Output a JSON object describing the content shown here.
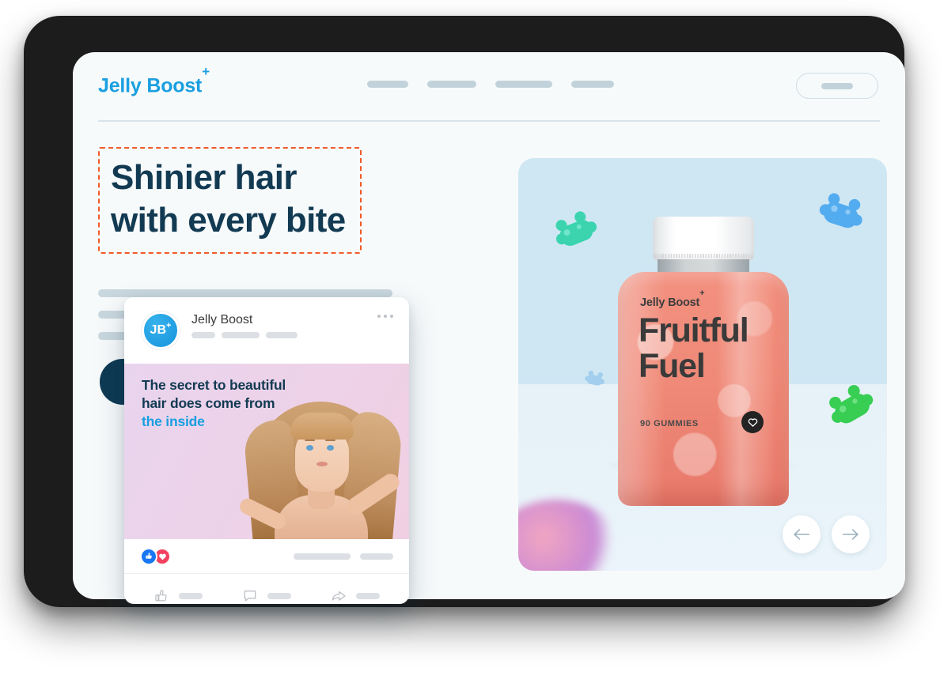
{
  "site": {
    "brand_name": "Jelly Boost",
    "brand_superscript": "+",
    "nav_placeholder_widths": [
      52,
      62,
      72,
      54
    ],
    "header_cta": "header-cta-button"
  },
  "hero": {
    "headline": "Shinier hair\nwith every bite",
    "headline_selected": true,
    "selection_border_color": "#f05a28",
    "headline_color": "#123a52",
    "body_placeholder_lines": 3,
    "cta_button_color": "#0e3a54"
  },
  "product": {
    "panel_background": "#cfe7f3",
    "bottle": {
      "brand": "Jelly Boost",
      "brand_superscript": "+",
      "title": "Fruitful\nFuel",
      "count": "90 GUMMIES",
      "badge_icon": "heart-icon",
      "fill_color": "#f08a78",
      "cap_color": "#ffffff"
    },
    "gummies": [
      {
        "name": "gummy-bear-teal",
        "color": "#2fd3aa"
      },
      {
        "name": "gummy-bear-blue",
        "color": "#4aa8f0"
      },
      {
        "name": "gummy-bear-green",
        "color": "#2ecc4a"
      },
      {
        "name": "gummy-bear-small-blue",
        "color": "#9cc9ec"
      }
    ],
    "carousel": {
      "prev_label": "previous-slide",
      "next_label": "next-slide"
    }
  },
  "social_card": {
    "account_name": "Jelly Boost",
    "avatar_initials": "JB",
    "avatar_superscript": "+",
    "avatar_color": "#1694dd",
    "menu_icon": "kebab-menu-icon",
    "post_text_line1": "The secret to beautiful",
    "post_text_line2": "hair does come from",
    "post_text_accent": "the inside",
    "accent_color": "#1a9fe0",
    "text_color": "#123a52",
    "reactions": [
      {
        "name": "reaction-like",
        "icon": "thumbs-up-icon",
        "color": "#1877f2"
      },
      {
        "name": "reaction-love",
        "icon": "heart-icon",
        "color": "#f3425f"
      }
    ],
    "actions": [
      {
        "name": "like-action",
        "icon": "thumbs-up-outline-icon"
      },
      {
        "name": "comment-action",
        "icon": "comment-icon"
      },
      {
        "name": "share-action",
        "icon": "share-arrow-icon"
      }
    ]
  }
}
